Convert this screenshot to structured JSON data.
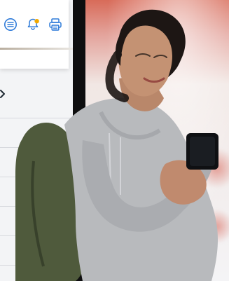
{
  "toolbar": {
    "icons": [
      "menu-icon",
      "bell-icon",
      "print-icon"
    ],
    "accent_color": "#2f7bd9",
    "notification_color": "#f2a900"
  },
  "ui": {
    "background": "#f3f4f6",
    "divider_color": "#0e0e0f"
  }
}
